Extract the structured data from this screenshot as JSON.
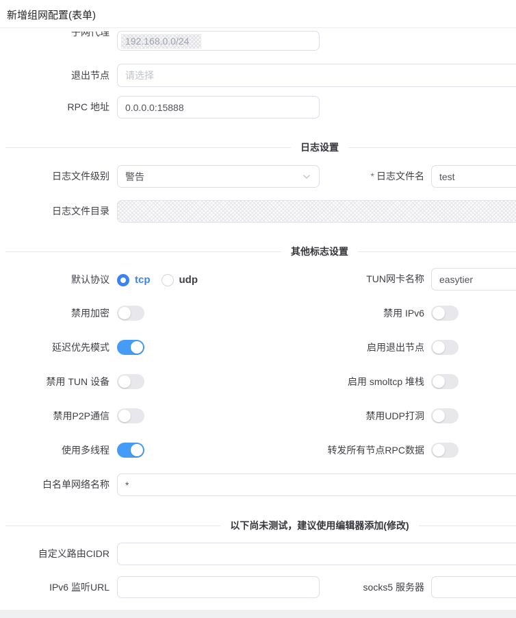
{
  "header": {
    "title": "新增组网配置(表单)"
  },
  "sections": {
    "log": "日志设置",
    "flags": "其他标志设置",
    "untested": "以下尚未测试，建议使用编辑器添加(修改)"
  },
  "fields": {
    "subnet_proxy": {
      "label": "子网代理",
      "value": "192.168.0.0/24"
    },
    "exit_node": {
      "label": "退出节点",
      "placeholder": "请选择"
    },
    "rpc_addr": {
      "label": "RPC 地址",
      "value": "0.0.0.0:15888"
    },
    "log_level": {
      "label": "日志文件级别",
      "value": "警告"
    },
    "log_file": {
      "label": "日志文件名",
      "required_mark": "*",
      "value": "test"
    },
    "log_dir": {
      "label": "日志文件目录",
      "value": ""
    },
    "protocol": {
      "label": "默认协议",
      "selected": "tcp",
      "options": [
        "tcp",
        "udp"
      ]
    },
    "tun_name": {
      "label": "TUN网卡名称",
      "value": "easytier"
    },
    "whitelist": {
      "label": "白名单网络名称",
      "value": "*"
    },
    "routes": {
      "label": "自定义路由CIDR",
      "value": ""
    },
    "ipv6_listener": {
      "label": "IPv6 监听URL",
      "value": ""
    },
    "socks5": {
      "label": "socks5 服务器",
      "value": ""
    }
  },
  "toggles": {
    "disable_encryption": {
      "label": "禁用加密",
      "on": false
    },
    "disable_ipv6": {
      "label": "禁用 IPv6",
      "on": false
    },
    "latency_first": {
      "label": "延迟优先模式",
      "on": true
    },
    "enable_exit_node": {
      "label": "启用退出节点",
      "on": false
    },
    "disable_tun": {
      "label": "禁用 TUN 设备",
      "on": false
    },
    "enable_smoltcp": {
      "label": "启用 smoltcp 堆栈",
      "on": false
    },
    "disable_p2p": {
      "label": "禁用P2P通信",
      "on": false
    },
    "disable_udp_hole_punching": {
      "label": "禁用UDP打洞",
      "on": false
    },
    "multi_thread": {
      "label": "使用多线程",
      "on": true
    },
    "relay_all_rpc": {
      "label": "转发所有节点RPC数据",
      "on": false
    }
  },
  "colors": {
    "accent": "#3b82f6",
    "toggle_on": "#459cf7",
    "toggle_off": "#e8e8ec"
  }
}
